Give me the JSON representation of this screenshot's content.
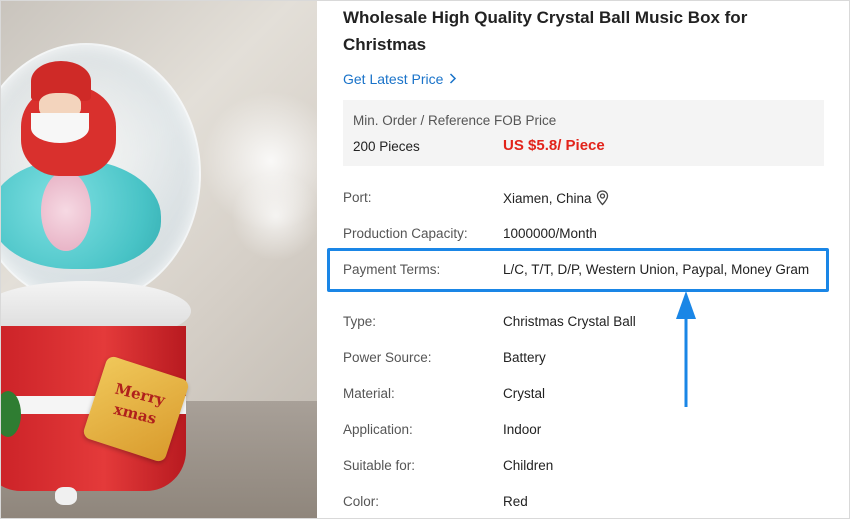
{
  "product": {
    "title": "Wholesale High Quality Crystal Ball Music Box for Christmas",
    "image_tag_text": [
      "Merry",
      "xmas"
    ]
  },
  "latest_price": {
    "label": "Get Latest Price",
    "icon": "chevron-right-icon"
  },
  "pricing": {
    "header": "Min. Order / Reference FOB Price",
    "quantity": "200 Pieces",
    "price": "US $5.8/ Piece",
    "price_color": "#e2231a"
  },
  "specs": [
    {
      "label": "Port:",
      "value": "Xiamen, China",
      "icon": "location-pin-icon"
    },
    {
      "label": "Production Capacity:",
      "value": "1000000/Month"
    },
    {
      "label": "Payment Terms:",
      "value": "L/C, T/T, D/P, Western Union, Paypal, Money Gram",
      "highlighted": true
    },
    {
      "label": "Type:",
      "value": "Christmas Crystal Ball"
    },
    {
      "label": "Power Source:",
      "value": "Battery"
    },
    {
      "label": "Material:",
      "value": "Crystal"
    },
    {
      "label": "Application:",
      "value": "Indoor"
    },
    {
      "label": "Suitable for:",
      "value": "Children"
    },
    {
      "label": "Color:",
      "value": "Red"
    }
  ],
  "colors": {
    "link": "#1a73c9",
    "highlight": "#1a86e6"
  }
}
